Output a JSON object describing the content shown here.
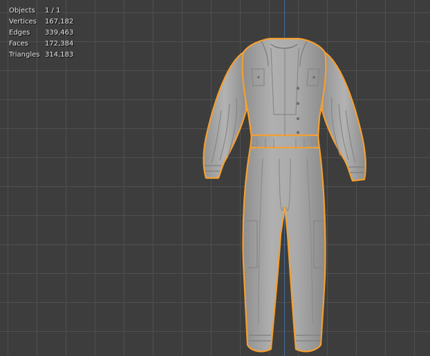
{
  "overlay": {
    "stats": [
      {
        "label": "Objects",
        "value": "1 / 1"
      },
      {
        "label": "Vertices",
        "value": "167,182"
      },
      {
        "label": "Edges",
        "value": "339,463"
      },
      {
        "label": "Faces",
        "value": "172,384"
      },
      {
        "label": "Triangles",
        "value": "314,183"
      }
    ]
  },
  "colors": {
    "background": "#3d3d3d",
    "grid": "#545454",
    "z_axis": "#3f6fa3",
    "selection_outline": "#f5a031",
    "mesh": "#a6a6a6"
  },
  "selected_object": {
    "icon": "jumpsuit-mesh",
    "selected": true
  }
}
